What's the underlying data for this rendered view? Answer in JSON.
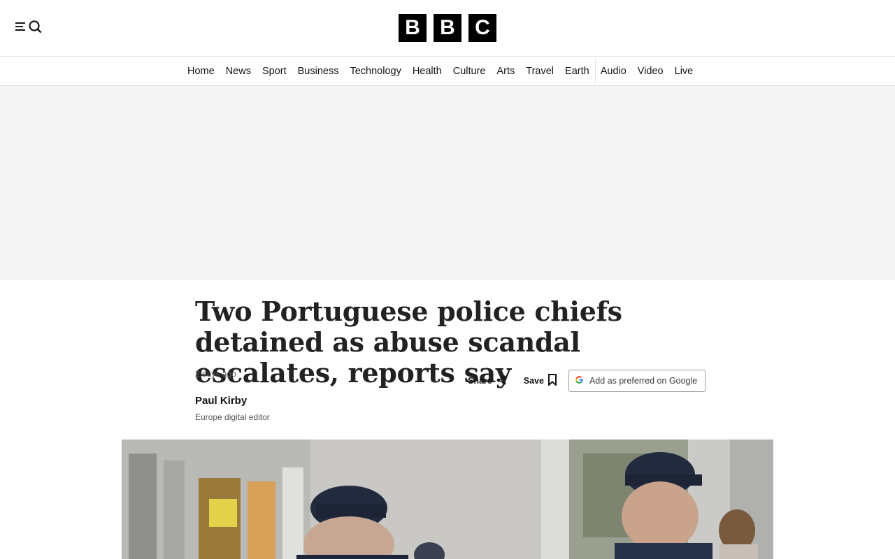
{
  "header": {
    "menu_icon": "menu-search-icon",
    "logo_letters": [
      "B",
      "B",
      "C"
    ]
  },
  "nav": {
    "items": [
      "Home",
      "News",
      "Sport",
      "Business",
      "Technology",
      "Health",
      "Culture",
      "Arts",
      "Travel",
      "Earth",
      "Audio",
      "Video",
      "Live"
    ]
  },
  "article": {
    "headline": "Two Portuguese police chiefs detained as abuse scandal escalates, reports say",
    "timestamp": "2 days ago",
    "author_name": "Paul Kirby",
    "author_role": "Europe digital editor",
    "share_label": "Share",
    "save_label": "Save",
    "google_label": "Add as preferred on Google",
    "share_icon": "share-icon",
    "save_icon": "bookmark-icon",
    "google_icon": "google-g-icon"
  },
  "colors": {
    "brand_black": "#000000",
    "ad_background": "#f5f5f5",
    "headline_text": "#202224"
  }
}
